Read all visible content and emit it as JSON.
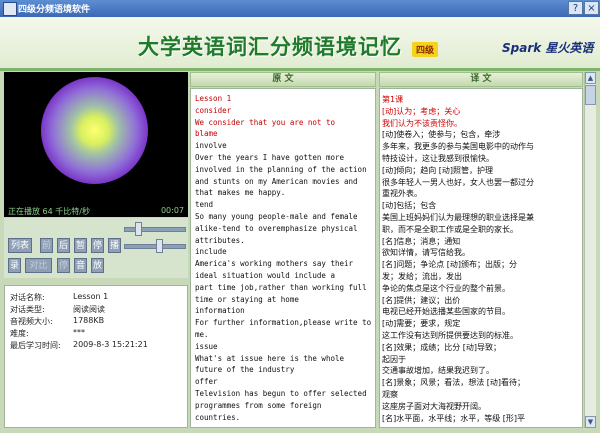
{
  "window": {
    "title": "四级分频语境软件"
  },
  "header": {
    "title": "大学英语词汇分频语境记忆",
    "level_badge": "四级",
    "brand": "Spark 星火英语"
  },
  "player": {
    "status": "正在播放 64 千比特/秒",
    "time": "00:07"
  },
  "controls": {
    "row1": [
      "列表",
      "前",
      "后",
      "暂",
      "停",
      "播"
    ],
    "row2": [
      "录",
      "对比",
      "停",
      "音",
      "放"
    ]
  },
  "info": {
    "rows": [
      {
        "label": "对话名称:",
        "value": "Lesson 1"
      },
      {
        "label": "对话类型:",
        "value": "阅读阅读"
      },
      {
        "label": "音视频大小:",
        "value": "1788KB"
      },
      {
        "label": "难度:",
        "value": "***"
      },
      {
        "label": "最后学习时间:",
        "value": "2009-8-3 15:21:21"
      }
    ]
  },
  "panes": {
    "original_header": "原 文",
    "translation_header": "译 文"
  },
  "original": [
    {
      "text": "Lesson 1",
      "red": true
    },
    {
      "text": "consider",
      "red": true
    },
    {
      "text": "We consider that you are not to",
      "red": true
    },
    {
      "text": "blame",
      "red": true
    },
    {
      "text": "involve",
      "red": false
    },
    {
      "text": "Over the years I have gotten more",
      "red": false
    },
    {
      "text": "involved in the planning of the action",
      "red": false
    },
    {
      "text": "and stunts on my American movies and",
      "red": false
    },
    {
      "text": "that makes me happy.",
      "red": false
    },
    {
      "text": "tend",
      "red": false
    },
    {
      "text": "So many young people-male and female",
      "red": false
    },
    {
      "text": "alike-tend to overemphasize physical",
      "red": false
    },
    {
      "text": "attributes.",
      "red": false
    },
    {
      "text": "include",
      "red": false
    },
    {
      "text": "America's working mothers say their",
      "red": false
    },
    {
      "text": "ideal situation would include a",
      "red": false
    },
    {
      "text": "part time job,rather than working full",
      "red": false
    },
    {
      "text": "time or staying at home",
      "red": false
    },
    {
      "text": "information",
      "red": false
    },
    {
      "text": "For further information,please write to",
      "red": false
    },
    {
      "text": "me.",
      "red": false
    },
    {
      "text": "issue",
      "red": false
    },
    {
      "text": "What's at issue here is the whole",
      "red": false
    },
    {
      "text": "future of the industry",
      "red": false
    },
    {
      "text": "offer",
      "red": false
    },
    {
      "text": "Television has begun to offer selected",
      "red": false
    },
    {
      "text": "programmes from some foreign",
      "red": false
    },
    {
      "text": "countries.",
      "red": false
    }
  ],
  "translation": [
    {
      "text": "第1课",
      "red": true
    },
    {
      "text": "[动]认为；考虑；关心",
      "red": true
    },
    {
      "text": "我们认为不该责怪你。",
      "red": true
    },
    {
      "text": "[动]使卷入；使参与；包含，牵涉",
      "red": false
    },
    {
      "text": "多年来，我更多的参与美国电影中的动作与",
      "red": false
    },
    {
      "text": "特技设计，这让我感到很愉快。",
      "red": false
    },
    {
      "text": "[动]倾向；趋向  [动]照管，护理",
      "red": false
    },
    {
      "text": "很多年轻人一男人也好，女人也罢一都过分",
      "red": false
    },
    {
      "text": "重视外表。",
      "red": false
    },
    {
      "text": "[动]包括；包含",
      "red": false
    },
    {
      "text": "美国上班妈妈们认为最理想的职业选择是兼",
      "red": false
    },
    {
      "text": "职，而不是全职工作或是全职的家长。",
      "red": false
    },
    {
      "text": "[名]信息；消息；通知",
      "red": false
    },
    {
      "text": "欲知详情，请写信给我。",
      "red": false
    },
    {
      "text": "[名]问题；争论点  [动]颁布；出版；分",
      "red": false
    },
    {
      "text": "发；发给；流出，发出",
      "red": false
    },
    {
      "text": "争论的焦点是这个行业的整个前景。",
      "red": false
    },
    {
      "text": "[名]提供；建议；出价",
      "red": false
    },
    {
      "text": "电视已经开始选播某些国家的节目。",
      "red": false
    },
    {
      "text": "[动]需要；要求，规定",
      "red": false
    },
    {
      "text": "这工作没有达到所提供要达到的标准。",
      "red": false
    },
    {
      "text": "[名]效果；成绩；比分  [动]导致；",
      "red": false
    },
    {
      "text": "起因于",
      "red": false
    },
    {
      "text": "交通事故增加，结果我迟到了。",
      "red": false
    },
    {
      "text": "[名]景象；风景；看法，想法  [动]看待；",
      "red": false
    },
    {
      "text": "观察",
      "red": false
    },
    {
      "text": "这座房子面对大海视野开阔。",
      "red": false
    },
    {
      "text": "[名]水平面，水平线；水平，等级  [形]平",
      "red": false
    }
  ]
}
